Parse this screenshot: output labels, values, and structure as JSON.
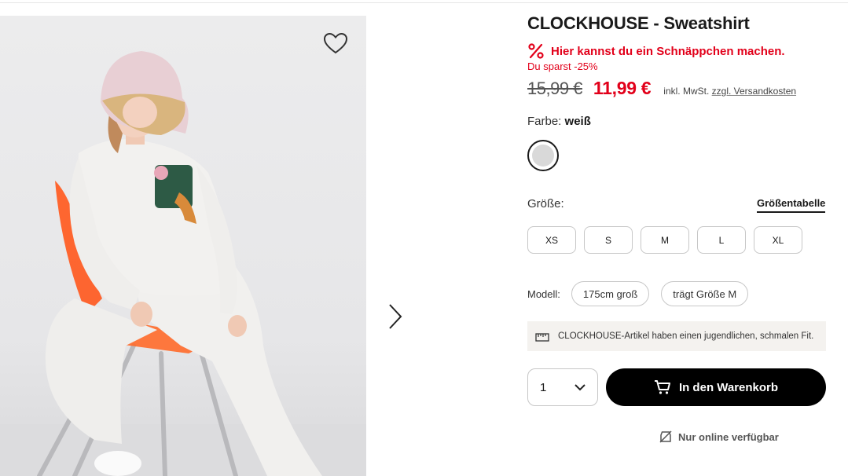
{
  "product": {
    "title": "CLOCKHOUSE - Sweatshirt",
    "deal_text": "Hier kannst du ein Schnäppchen machen.",
    "saving_text": "Du sparst -25%",
    "old_price": "15,99 €",
    "new_price": "11,99 €",
    "tax_text": "inkl. MwSt.",
    "shipping_link": "zzgl. Versandkosten"
  },
  "color": {
    "label": "Farbe:",
    "value": "weiß",
    "swatch_hex": "#d9d9d9"
  },
  "size": {
    "label": "Größe:",
    "chart_link": "Größentabelle",
    "options": [
      "XS",
      "S",
      "M",
      "L",
      "XL"
    ]
  },
  "model": {
    "label": "Modell:",
    "height": "175cm groß",
    "size_worn": "trägt Größe M"
  },
  "fit_note": "CLOCKHOUSE-Artikel haben einen jugendlichen, schmalen Fit.",
  "quantity": {
    "value": "1"
  },
  "cart_button": "In den Warenkorb",
  "availability": "Nur online verfügbar",
  "icons": {
    "favorite": "heart-icon",
    "next": "chevron-right-icon",
    "deal": "percent-icon",
    "fit": "ruler-icon",
    "cart": "cart-icon",
    "availability": "store-off-icon"
  },
  "colors": {
    "accent_red": "#e2001a",
    "button_black": "#000000"
  }
}
